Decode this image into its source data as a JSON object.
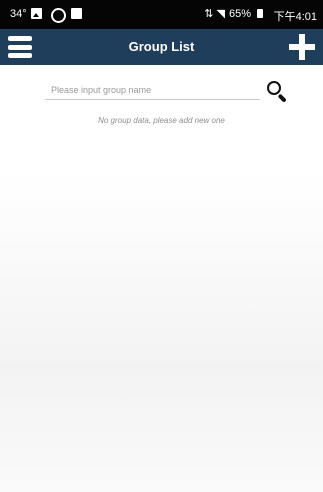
{
  "status_bar": {
    "temperature": "34°",
    "battery_percent": "65%",
    "time": "下午4:01"
  },
  "header": {
    "title": "Group List"
  },
  "search": {
    "placeholder": "Please input group name"
  },
  "empty_message": "No group data, please add new one",
  "colors": {
    "header_bg": "#1f3e5c",
    "status_bar_bg": "#050505"
  }
}
